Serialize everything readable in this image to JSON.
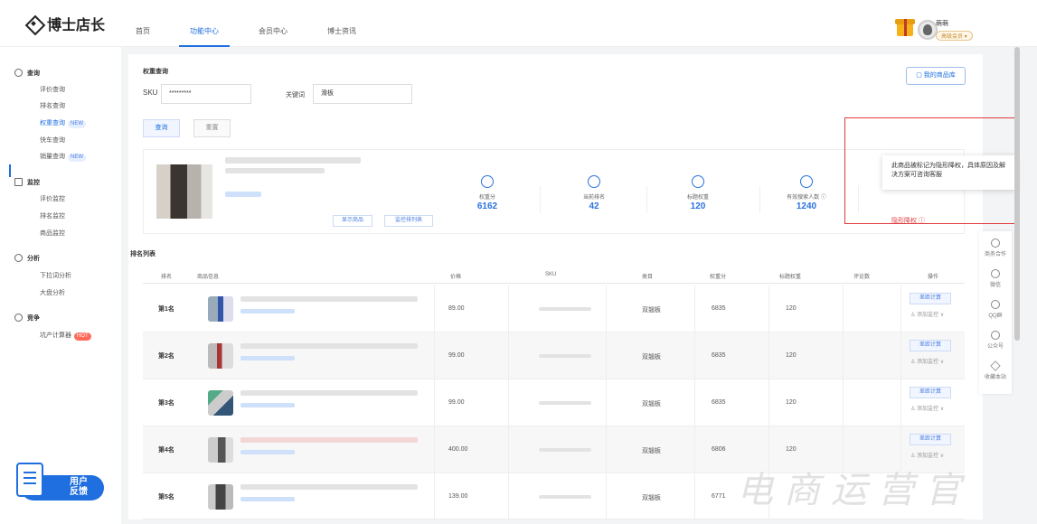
{
  "header": {
    "logo": "博士店长",
    "nav": [
      "首页",
      "功能中心",
      "会员中心",
      "博士资讯"
    ],
    "user_name": "萌萌",
    "user_badge": "高级会员 ▾"
  },
  "sidebar": {
    "groups": [
      {
        "title": "查询",
        "items": [
          {
            "label": "评价查询"
          },
          {
            "label": "排名查询"
          },
          {
            "label": "权重查询",
            "tag": "NEW"
          },
          {
            "label": "快车查询"
          },
          {
            "label": "销量查询",
            "tag": "NEW"
          }
        ]
      },
      {
        "title": "监控",
        "items": [
          {
            "label": "评价监控"
          },
          {
            "label": "排名监控"
          },
          {
            "label": "商品监控"
          }
        ]
      },
      {
        "title": "分析",
        "items": [
          {
            "label": "下拉词分析"
          },
          {
            "label": "大盘分析"
          }
        ]
      },
      {
        "title": "竞争",
        "items": [
          {
            "label": "坑产计算器",
            "tag": "HOT"
          }
        ]
      }
    ],
    "feedback_line1": "用户",
    "feedback_line2": "反馈"
  },
  "query": {
    "section_title": "权重查询",
    "sku_label": "SKU",
    "sku_value": "*********",
    "keyword_label": "关键词",
    "keyword_value": "滑板",
    "btn_query": "查询",
    "btn_reset": "重置",
    "btn_lib": "我的商品库"
  },
  "product_card": {
    "btn_show": "显示商品",
    "btn_monitor": "监控排列表",
    "metrics": [
      {
        "label": "权重分",
        "value": "6162"
      },
      {
        "label": "当前排名",
        "value": "42"
      },
      {
        "label": "标题权重",
        "value": "120"
      },
      {
        "label": "有效搜索人数 ⓘ",
        "value": "1240"
      }
    ],
    "status_value": "隐形降权 ⓘ",
    "tooltip": "此商品被标记为隐形降权，具体原因及解决方案可咨询客服"
  },
  "ranking": {
    "section_title": "排名列表",
    "columns": [
      "排名",
      "商品信息",
      "价格",
      "SKU",
      "类目",
      "权重分",
      "标题权重",
      "评论数",
      "操作"
    ],
    "rows": [
      {
        "rank": "第1名",
        "price": "89.00",
        "category": "双翘板",
        "weight": "6835",
        "title_weight": "120"
      },
      {
        "rank": "第2名",
        "price": "99.00",
        "category": "双翘板",
        "weight": "6835",
        "title_weight": "120"
      },
      {
        "rank": "第3名",
        "price": "99.00",
        "category": "双翘板",
        "weight": "6835",
        "title_weight": "120"
      },
      {
        "rank": "第4名",
        "price": "400.00",
        "category": "双翘板",
        "weight": "6806",
        "title_weight": "120"
      },
      {
        "rank": "第5名",
        "price": "139.00",
        "category": "双翘板",
        "weight": "6771",
        "title_weight": ""
      }
    ],
    "op_btn": "差距计算",
    "op_link": "♙ 添加监控 ∨"
  },
  "float_bar": [
    "商务合作",
    "微信",
    "QQ群",
    "公众号",
    "收藏本站"
  ],
  "watermark": "电商运营官"
}
